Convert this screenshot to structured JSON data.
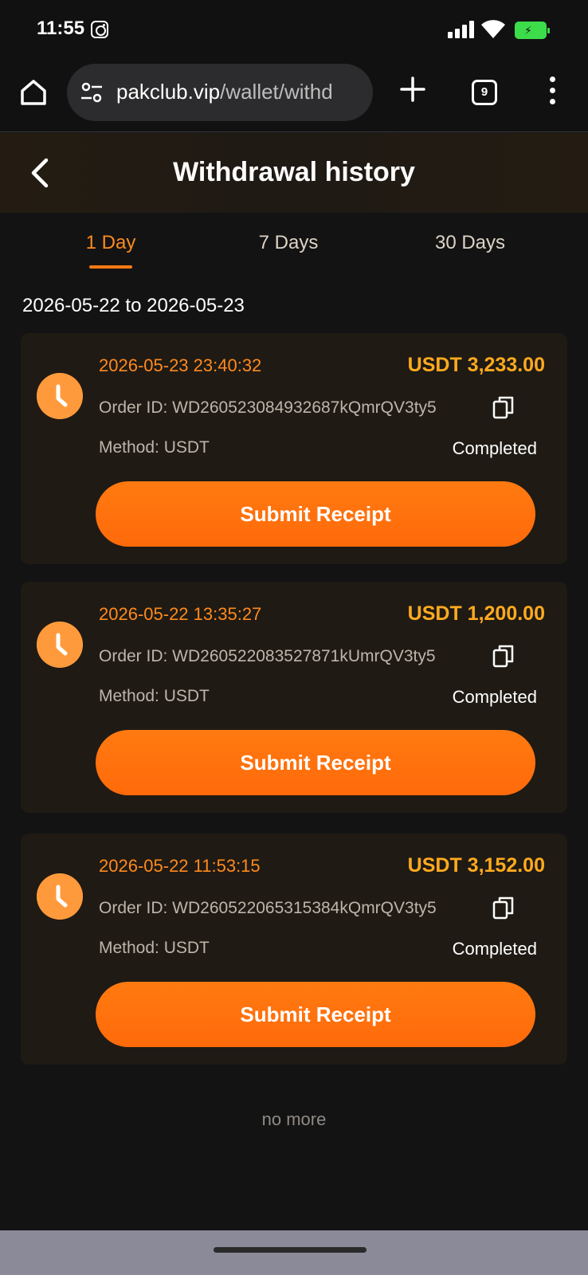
{
  "status_bar": {
    "time": "11:55"
  },
  "browser": {
    "url_host": "pakclub.vip",
    "url_path": "/wallet/withd",
    "tab_count": "9"
  },
  "header": {
    "title": "Withdrawal history"
  },
  "tabs": [
    {
      "label": "1 Day",
      "active": true
    },
    {
      "label": "7 Days",
      "active": false
    },
    {
      "label": "30 Days",
      "active": false
    }
  ],
  "date_range": "2026-05-22 to 2026-05-23",
  "records": [
    {
      "datetime": "2026-05-23 23:40:32",
      "amount": "USDT 3,233.00",
      "order_id": "Order ID: WD260523084932687kQmrQV3ty5",
      "method": "Method: USDT",
      "status": "Completed",
      "button_label": "Submit Receipt"
    },
    {
      "datetime": "2026-05-22 13:35:27",
      "amount": "USDT 1,200.00",
      "order_id": "Order ID: WD260522083527871kUmrQV3ty5",
      "method": "Method: USDT",
      "status": "Completed",
      "button_label": "Submit Receipt"
    },
    {
      "datetime": "2026-05-22 11:53:15",
      "amount": "USDT 3,152.00",
      "order_id": "Order ID: WD260522065315384kQmrQV3ty5",
      "method": "Method: USDT",
      "status": "Completed",
      "button_label": "Submit Receipt"
    }
  ],
  "footer_text": "no more",
  "colors": {
    "accent": "#ff7a12",
    "amount": "#ffaa1e",
    "background": "#131313",
    "card": "#1f1a14"
  }
}
